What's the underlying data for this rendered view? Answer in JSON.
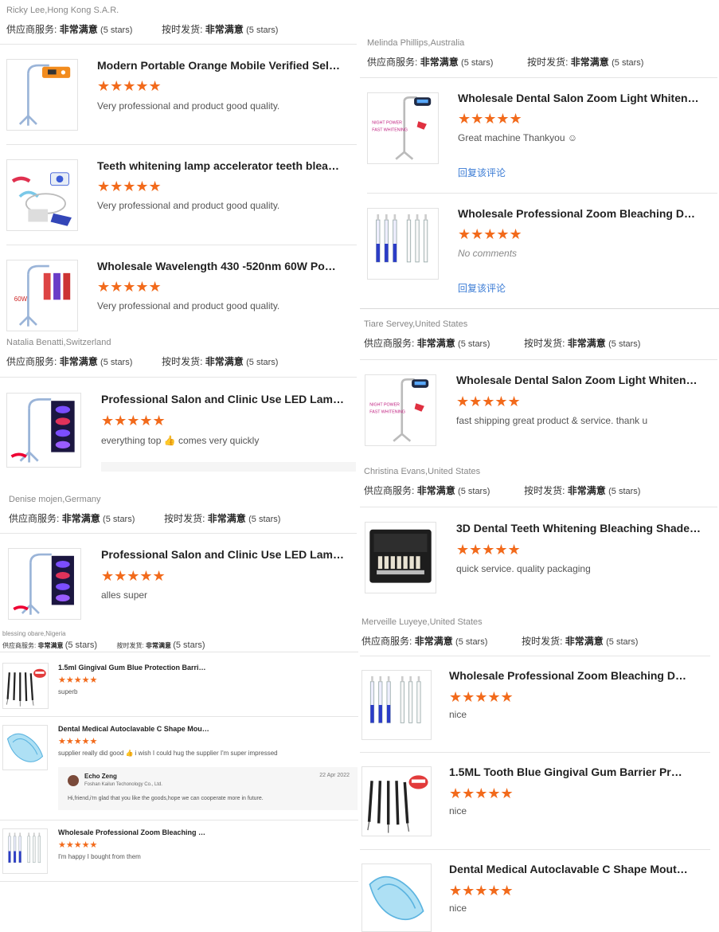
{
  "labels": {
    "supplier_service": "供应商服务:",
    "on_time": "按时发货:",
    "very_satisfied": "非常满意",
    "five_stars": "(5 stars)",
    "reply_link": "回复该评论",
    "star_glyphs": "★★★★★"
  },
  "colors": {
    "star": "#f26a1b",
    "link": "#3a7bd5",
    "divider": "#e5e5e5"
  },
  "left": {
    "reviewers": [
      {
        "name": "Ricky Lee,Hong Kong S.A.R."
      },
      {
        "name": "Natalia Benatti,Switzerland"
      },
      {
        "name": "Denise mojen,Germany"
      },
      {
        "name": "blessing obare,Nigeria"
      }
    ],
    "items": [
      {
        "title": "Modern Portable Orange Mobile Verified Seller ...",
        "comment": "Very professional and product good quality.",
        "icon": "orange-whitening-lamp"
      },
      {
        "title": "Teeth whitening lamp accelerator teeth bleachi...",
        "comment": "Very professional and product good quality.",
        "icon": "whitening-kit"
      },
      {
        "title": "Wholesale Wavelength 430 -520nm 60W Porta...",
        "comment": "Very professional and product good quality.",
        "icon": "led-lamp-stand"
      },
      {
        "title": "Professional Salon and Clinic Use LED Lamp D...",
        "comment": "everything top 👍 comes very quickly",
        "icon": "led-lamp-panel"
      },
      {
        "title": "Professional Salon and Clinic Use LED Lamp D...",
        "comment": "alles super",
        "icon": "led-lamp-panel"
      },
      {
        "title": "1.5ml Gingival Gum Blue Protection Barrier Gel...",
        "comment": "superb",
        "icon": "gum-barrier-syringes"
      },
      {
        "title": "Dental Medical Autoclavable C Shape Mouth O...",
        "comment": "supplier really did good 👍  i wish I could hug the supplier I'm super impressed",
        "icon": "mouth-opener"
      },
      {
        "title": "Wholesale Professional Zoom Bleaching Denta...",
        "comment": "I'm happy I bought from them",
        "icon": "bleaching-syringes"
      }
    ],
    "seller_reply": {
      "name": "Echo Zeng",
      "company": "Foshan Kailun Techonology Co., Ltd.",
      "date": "22 Apr 2022",
      "text": "Hi,friend,i'm glad that you like the goods,hope we can cooperate more in future."
    }
  },
  "right": {
    "reviewers": [
      {
        "name": "Melinda Phillips,Australia"
      },
      {
        "name": "Tiare Servey,United States"
      },
      {
        "name": "Christina Evans,United States"
      },
      {
        "name": "Merveille Luyeye,United States"
      }
    ],
    "items": [
      {
        "title": "Wholesale Dental Salon Zoom Light Whitening ...",
        "comment": "Great machine Thankyou ☺",
        "icon": "zoom-light-stand"
      },
      {
        "title": "Wholesale Professional Zoom Bleaching Denta...",
        "comment": "No comments",
        "icon": "bleaching-syringes"
      },
      {
        "title": "Wholesale Dental Salon Zoom Light Whitening ...",
        "comment": "fast shipping great product & service. thank u",
        "icon": "zoom-light-stand"
      },
      {
        "title": "3D Dental Teeth Whitening Bleaching Shade Gu...",
        "comment": "quick service. quality packaging",
        "icon": "shade-guide-case"
      },
      {
        "title": "Wholesale Professional Zoom Bleaching Denta...",
        "comment": "nice",
        "icon": "bleaching-syringes"
      },
      {
        "title": "1.5ML Tooth Blue Gingival Gum Barrier Protecti...",
        "comment": "nice",
        "icon": "gum-barrier-syringes"
      },
      {
        "title": "Dental Medical Autoclavable C Shape Mouth O...",
        "comment": "nice",
        "icon": "mouth-opener"
      }
    ]
  }
}
